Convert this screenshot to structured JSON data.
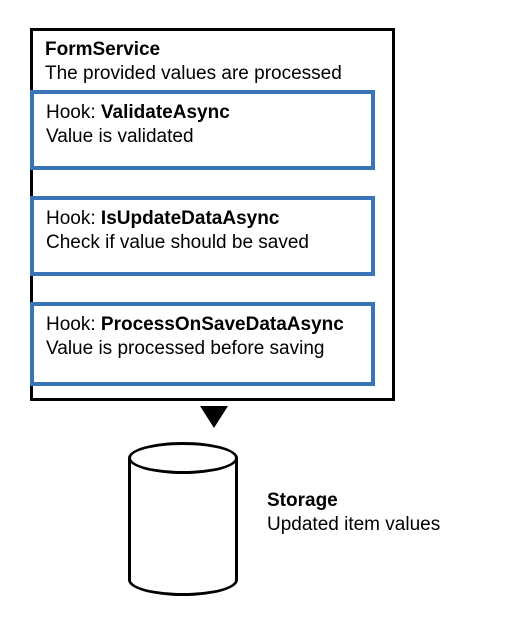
{
  "service": {
    "title": "FormService",
    "subtitle": "The provided values are processed"
  },
  "hooks": [
    {
      "label": "Hook: ",
      "name": "ValidateAsync",
      "desc": "Value is validated"
    },
    {
      "label": "Hook: ",
      "name": "IsUpdateDataAsync",
      "desc": "Check if value should be saved"
    },
    {
      "label": "Hook: ",
      "name": "ProcessOnSaveDataAsync",
      "desc": "Value is processed before saving"
    }
  ],
  "storage": {
    "title": "Storage",
    "subtitle": "Updated item values"
  }
}
